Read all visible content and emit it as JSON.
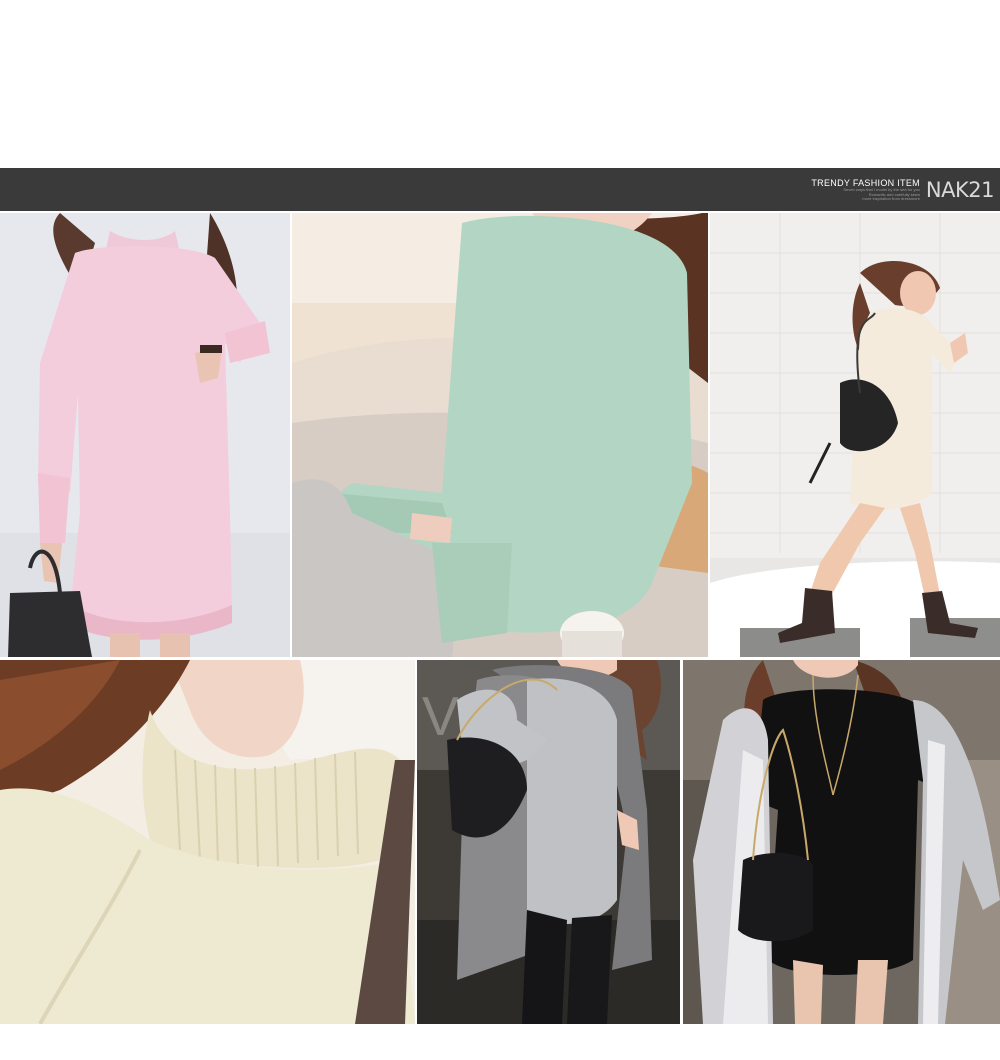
{
  "banner": {
    "tagline": "TRENDY FASHION ITEM",
    "sub_lines": [
      "Seven ways that I model by the sea for you",
      "Romantic and carefully sewn",
      "more inspiration from dressmore"
    ],
    "logo": "NAK21",
    "background": "#3a3a3a"
  },
  "photos": [
    {
      "subject": "pink knit dress"
    },
    {
      "subject": "mint knit dress"
    },
    {
      "subject": "ivory knit dress"
    },
    {
      "subject": "ivory knit collar detail"
    },
    {
      "subject": "grey knit dress with vest"
    },
    {
      "subject": "black knit dress with coat"
    }
  ]
}
